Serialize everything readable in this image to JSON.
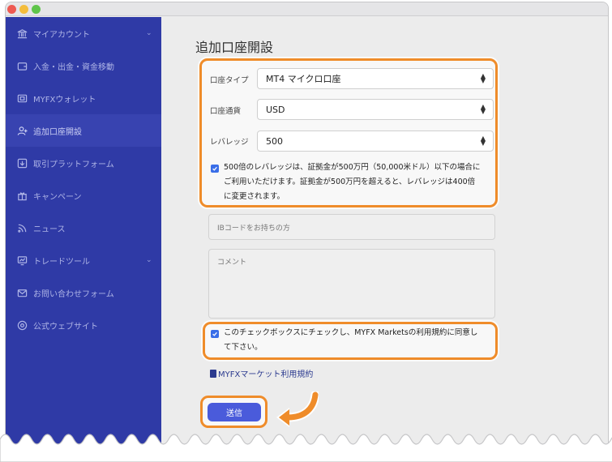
{
  "sidebar": {
    "items": [
      {
        "label": "マイアカウント",
        "icon": "bank-icon",
        "chevron": "⌄"
      },
      {
        "label": "入金・出金・資金移動",
        "icon": "wallet-icon"
      },
      {
        "label": "MYFXウォレット",
        "icon": "card-icon"
      },
      {
        "label": "追加口座開設",
        "icon": "add-user-icon"
      },
      {
        "label": "取引プラットフォーム",
        "icon": "download-icon"
      },
      {
        "label": "キャンペーン",
        "icon": "gift-icon"
      },
      {
        "label": "ニュース",
        "icon": "rss-icon"
      },
      {
        "label": "トレードツール",
        "icon": "chart-icon",
        "chevron": "⌄"
      },
      {
        "label": "お問い合わせフォーム",
        "icon": "mail-icon"
      },
      {
        "label": "公式ウェブサイト",
        "icon": "globe-icon"
      }
    ]
  },
  "main": {
    "title": "追加口座開設",
    "account_type": {
      "label": "口座タイプ",
      "value": "MT4 マイクロ口座"
    },
    "currency": {
      "label": "口座通貨",
      "value": "USD"
    },
    "leverage": {
      "label": "レバレッジ",
      "value": "500"
    },
    "leverage_note": {
      "line1": "500倍のレバレッジは、証拠金が500万円（50,000米ドル）以下の場合に",
      "line2": "ご利用いただけます。証拠金が500万円を超えると、レバレッジは400倍",
      "line3": "に変更されます。"
    },
    "ib_code": {
      "placeholder": "IBコードをお持ちの方"
    },
    "comment": {
      "placeholder": "コメント"
    },
    "terms_check": {
      "line1": "このチェックボックスにチェックし、MYFX Marketsの利用規約に同意し",
      "line2": "て下さい。"
    },
    "terms_link": "MYFXマーケット利用規約",
    "submit_label": "送信"
  },
  "colors": {
    "sidebar": "#2f3aa6",
    "highlight": "#ef8c2a",
    "submit": "#4a5bdb",
    "checkbox": "#3a6ee8"
  }
}
